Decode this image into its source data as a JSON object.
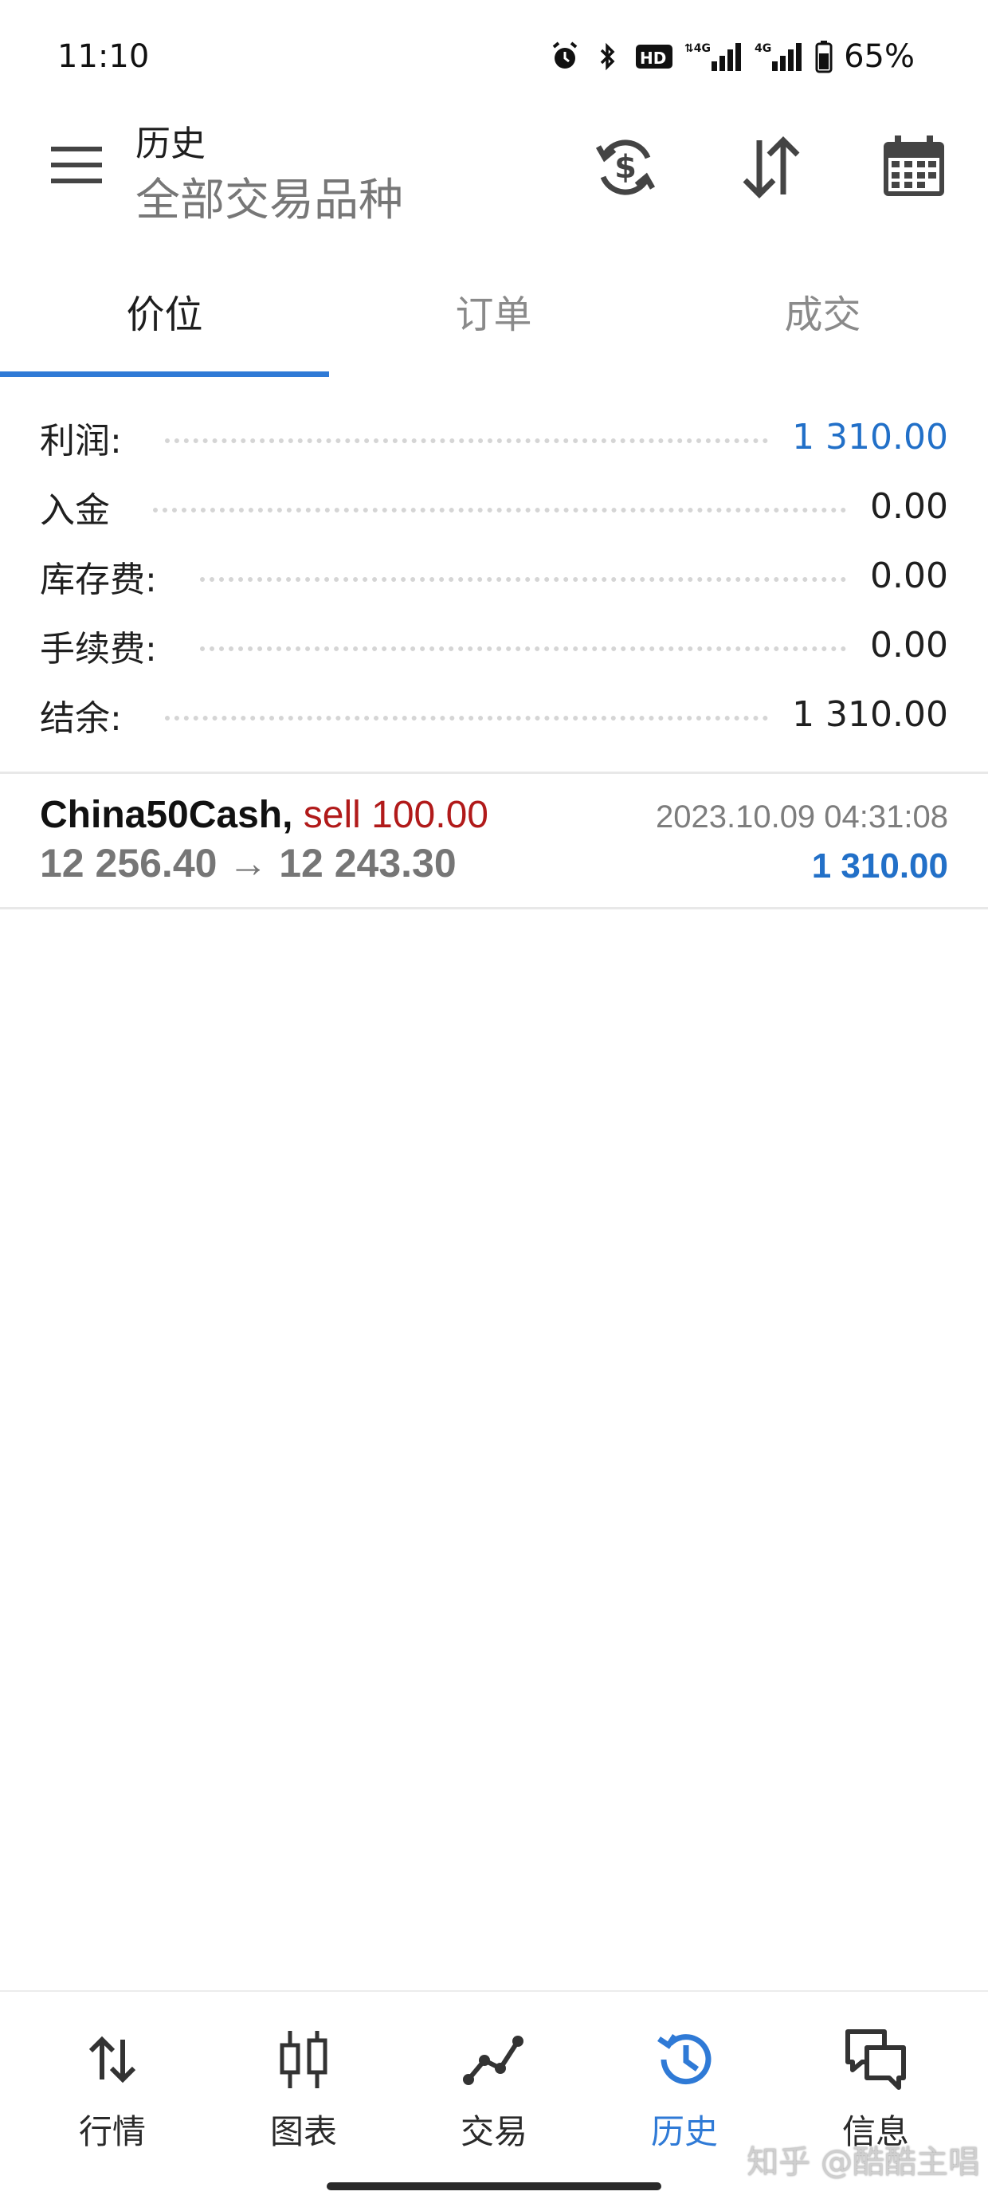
{
  "status_bar": {
    "time": "11:10",
    "battery": "65%"
  },
  "header": {
    "title": "历史",
    "subtitle": "全部交易品种"
  },
  "tabs": [
    {
      "label": "价位",
      "active": true
    },
    {
      "label": "订单",
      "active": false
    },
    {
      "label": "成交",
      "active": false
    }
  ],
  "summary": [
    {
      "label": "利润:",
      "value": "1 310.00",
      "highlight": true
    },
    {
      "label": "入金",
      "value": "0.00",
      "highlight": false
    },
    {
      "label": "库存费:",
      "value": "0.00",
      "highlight": false
    },
    {
      "label": "手续费:",
      "value": "0.00",
      "highlight": false
    },
    {
      "label": "结余:",
      "value": "1 310.00",
      "highlight": false
    }
  ],
  "deal": {
    "symbol": "China50Cash,",
    "type": "sell 100.00",
    "prices": "12 256.40 → 12 243.30",
    "time": "2023.10.09 04:31:08",
    "profit": "1 310.00"
  },
  "bottom_nav": [
    {
      "label": "行情",
      "icon": "quotes-arrows-icon"
    },
    {
      "label": "图表",
      "icon": "candlestick-chart-icon"
    },
    {
      "label": "交易",
      "icon": "trade-line-icon"
    },
    {
      "label": "历史",
      "icon": "history-clock-icon",
      "active": true
    },
    {
      "label": "信息",
      "icon": "messages-icon"
    }
  ],
  "watermark": "知乎 @酷酷主唱",
  "colors": {
    "accent": "#2f7ad6",
    "profit_blue": "#2270c8",
    "sell_red": "#b11a1a"
  }
}
